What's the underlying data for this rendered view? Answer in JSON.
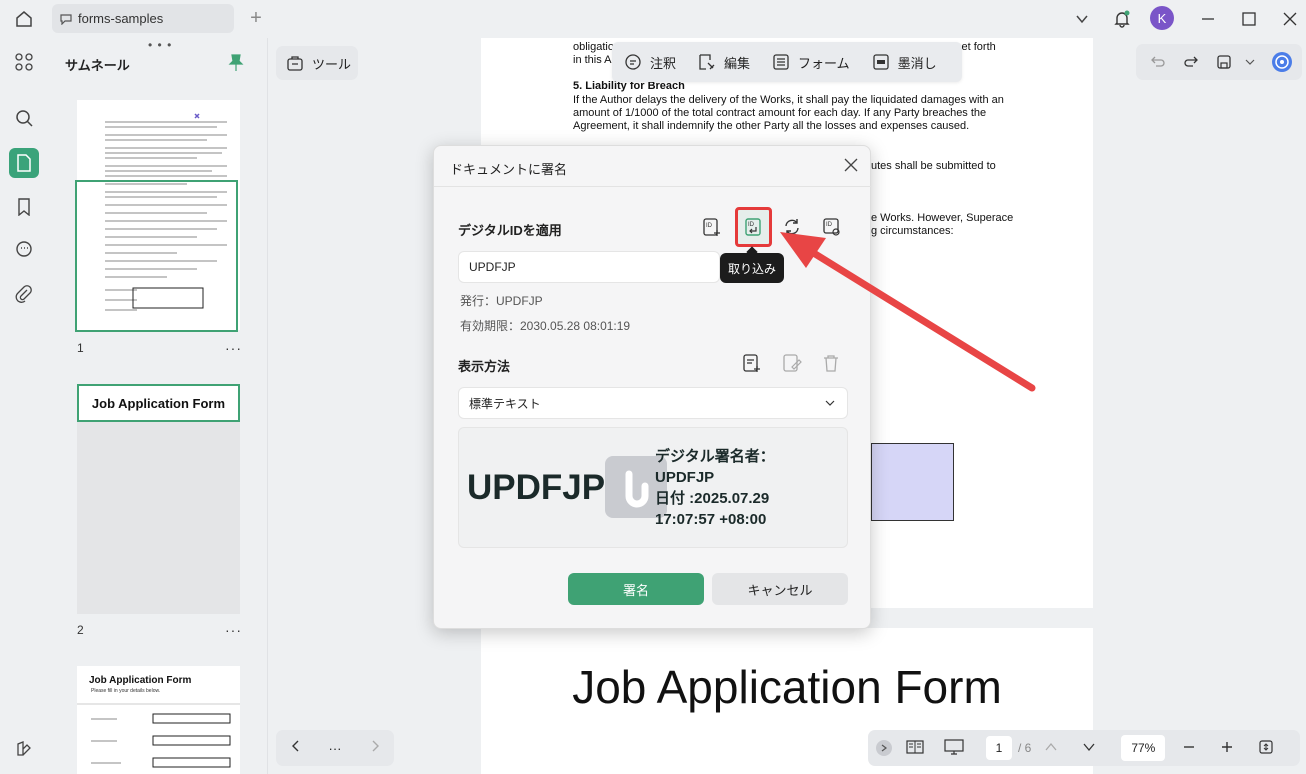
{
  "tab": {
    "title": "forms-samples"
  },
  "avatar": {
    "initial": "K"
  },
  "thumbnails": {
    "title": "サムネール",
    "pages": [
      {
        "number": "1",
        "more": "···"
      },
      {
        "number": "2",
        "more": "···",
        "heading": "Job Application Form"
      },
      {
        "heading": "Job Application Form",
        "sub": "Please fill in your details below."
      }
    ]
  },
  "toolbar": {
    "tool_label": "ツール",
    "modes": [
      "注釈",
      "編集",
      "フォーム",
      "墨消し"
    ]
  },
  "document": {
    "lines": [
      "obligation",
      "in this Ag",
      "5.           Liability for Breach",
      "If the Author delays the delivery of the Works, it shall pay the liquidated damages with an",
      "amount of 1/1000 of the total contract amount for each day. If any Party breaches the",
      "Agreement, it shall indemnify the other Party all the losses and expenses caused."
    ],
    "right_fragments": [
      "set forth",
      "utes shall be submitted to",
      "e Works. However, Superace",
      "g circumstances:"
    ],
    "page2_title": "Job Application Form"
  },
  "dialog": {
    "title": "ドキュメントに署名",
    "digital_id_label": "デジタルIDを適用",
    "id_value": "UPDFJP",
    "issuer": "発行：UPDFJP",
    "expiry": "有効期限：2030.05.28 08:01:19",
    "tooltip": "取り込み",
    "display_label": "表示方法",
    "display_value": "標準テキスト",
    "preview": {
      "name": "UPDFJP",
      "line1": "デジタル署名者：",
      "line2": "UPDFJP",
      "line3": "日付 :2025.07.29",
      "line4": "17:07:57 +08:00"
    },
    "sign_button": "署名",
    "cancel_button": "キャンセル"
  },
  "pager": {
    "current": "1",
    "total": "/ 6",
    "zoom": "77%"
  },
  "colors": {
    "accent": "#3fa274",
    "highlight": "#e53a3a"
  }
}
